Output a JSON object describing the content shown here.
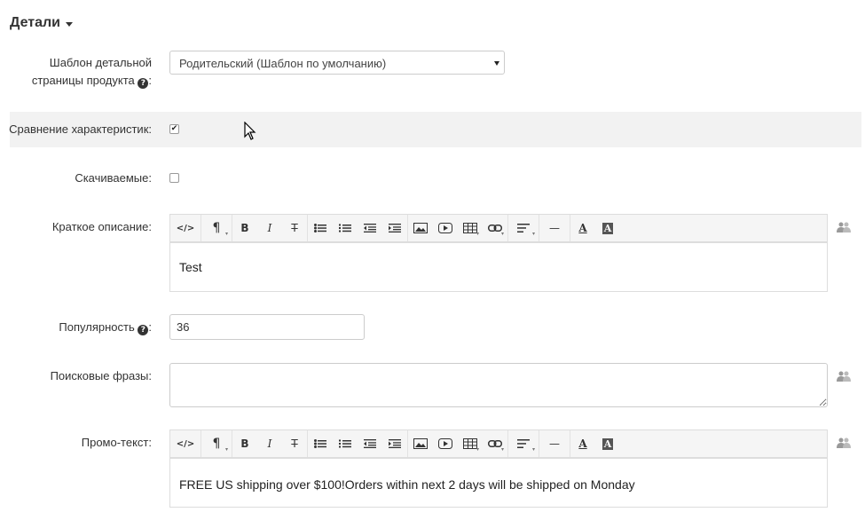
{
  "section": {
    "title": "Детали"
  },
  "fields": {
    "template": {
      "label_line1": "Шаблон детальной",
      "label_line2": "страницы продукта",
      "help": "?",
      "value": "Родительский (Шаблон по умолчанию)"
    },
    "compare": {
      "label": "Сравнение характеристик:",
      "checked": true,
      "check_mark": "✔"
    },
    "downloadable": {
      "label": "Скачиваемые:",
      "checked": false
    },
    "short_description": {
      "label": "Краткое описание:",
      "value": "Test"
    },
    "popularity": {
      "label": "Популярность",
      "help": "?",
      "value": "36"
    },
    "search_words": {
      "label": "Поисковые фразы:",
      "value": ""
    },
    "promo_text": {
      "label": "Промо-текст:",
      "value": "FREE US shipping over $100!Orders within next 2 days will be shipped on Monday"
    }
  },
  "toolbar": {
    "html": "</>",
    "paragraph": "¶",
    "bold": "B",
    "italic": "I",
    "strike": "T",
    "hr": "—",
    "font_color": "A",
    "bg_color": "A"
  },
  "colors": {
    "highlight_row": "#f2f2f2",
    "border": "#cccccc",
    "toolbar_bg": "#f5f5f5"
  }
}
